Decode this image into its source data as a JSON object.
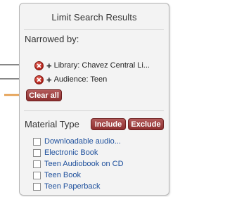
{
  "panel": {
    "title": "Limit Search Results"
  },
  "narrowed": {
    "heading": "Narrowed by:",
    "filters": [
      {
        "plus": "+",
        "text": "Library: Chavez Central Li..."
      },
      {
        "plus": "+",
        "text": "Audience: Teen"
      }
    ],
    "clear_all": "Clear all"
  },
  "material_type": {
    "heading": "Material Type",
    "include_label": "Include",
    "exclude_label": "Exclude",
    "options": [
      "Downloadable audio...",
      "Electronic Book",
      "Teen Audiobook on CD",
      "Teen Book",
      "Teen Paperback"
    ]
  },
  "colors": {
    "button": "#8d2f2f",
    "link": "#1d4f9c",
    "callout_arrow": "#e39b4a"
  }
}
